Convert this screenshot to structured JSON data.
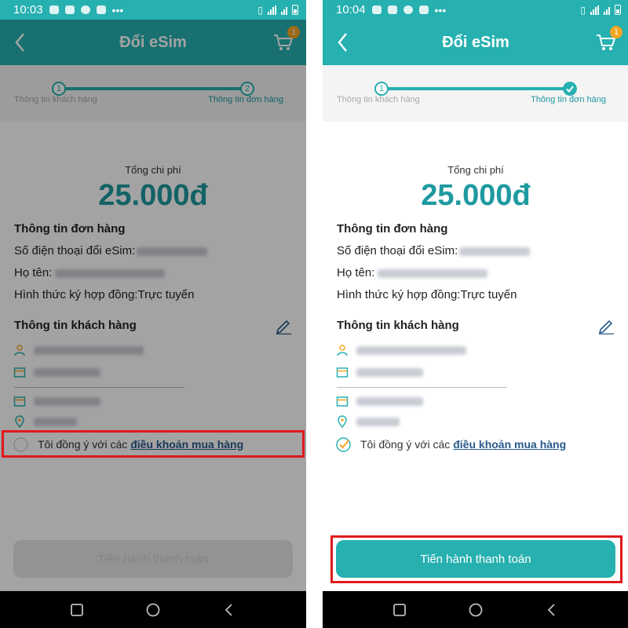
{
  "colors": {
    "teal": "#27b0b0",
    "teal_dark": "#1e9aa0",
    "link": "#2a5a8a",
    "highlight": "#e0191d",
    "badge": "#f5a623"
  },
  "screens": [
    {
      "status_time": "10:03",
      "app_title": "Đổi eSim",
      "cart_badge": "1",
      "steps": [
        {
          "number": "1",
          "label": "Thông tin khách hàng"
        },
        {
          "number": "2",
          "label": "Thông tin đơn hàng"
        }
      ],
      "total_label": "Tổng chi phí",
      "total_value": "25.000đ",
      "order_title": "Thông tin đơn hàng",
      "order_phone_label": "Số điện thoại đổi eSim:",
      "order_name_label": "Họ tên:",
      "order_contract": "Hình thức ký hợp đồng:Trực tuyến",
      "customer_title": "Thông tin khách hàng",
      "agree_text": "Tôi đồng ý với các",
      "agree_link": "điều khoản mua hàng",
      "agree_checked": false,
      "pay_button": "Tiến hành thanh toán",
      "pay_enabled": false
    },
    {
      "status_time": "10:04",
      "app_title": "Đổi eSim",
      "cart_badge": "1",
      "steps": [
        {
          "number": "1",
          "label": "Thông tin khách hàng"
        },
        {
          "number": "",
          "label": "Thông tin đơn hàng"
        }
      ],
      "total_label": "Tổng chi phí",
      "total_value": "25.000đ",
      "order_title": "Thông tin đơn hàng",
      "order_phone_label": "Số điện thoại đổi eSim:",
      "order_name_label": "Họ tên:",
      "order_contract": "Hình thức ký hợp đồng:Trực tuyến",
      "customer_title": "Thông tin khách hàng",
      "agree_text": "Tôi đồng ý với các",
      "agree_link": "điều khoản mua hàng",
      "agree_checked": true,
      "pay_button": "Tiến hành thanh toán",
      "pay_enabled": true
    }
  ]
}
